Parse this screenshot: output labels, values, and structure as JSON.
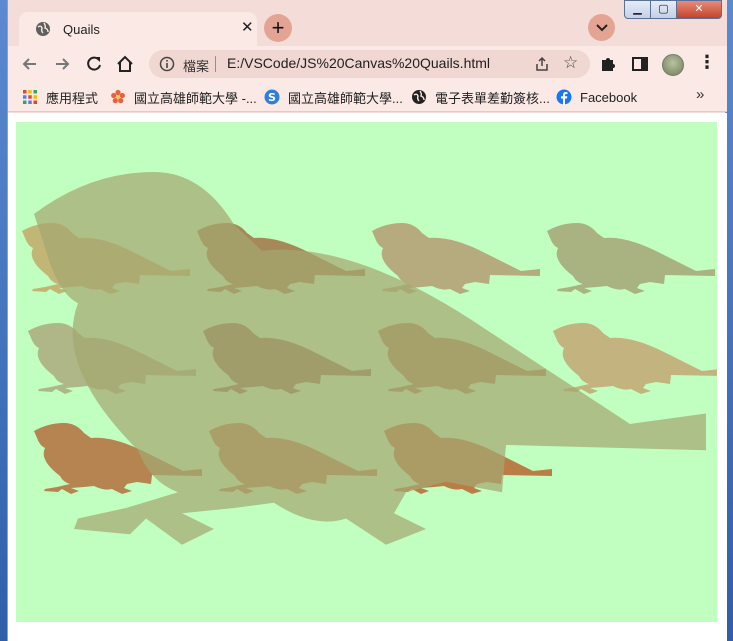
{
  "tab": {
    "title": "Quails",
    "favicon": "globe-icon",
    "close": "✕"
  },
  "new_tab": "+",
  "window_controls": {
    "minimize": "▁",
    "maximize": "▢",
    "close": "✕"
  },
  "toolbar": {
    "back": "back-arrow-icon",
    "forward": "forward-arrow-icon",
    "reload": "reload-icon",
    "home": "home-icon",
    "extensions": "puzzle-icon",
    "side_panel": "side-panel-icon",
    "menu": "⋮"
  },
  "omnibox": {
    "label": "檔案",
    "url": "E:/VSCode/JS%20Canvas%20Quails.html"
  },
  "bookmarks": {
    "items": [
      {
        "label": "應用程式",
        "icon": "apps-grid-icon"
      },
      {
        "label": "國立高雄師範大學 -...",
        "icon": "nknu-flower-icon"
      },
      {
        "label": "國立高雄師範大學...",
        "icon": "s-logo-icon"
      },
      {
        "label": "電子表單差勤簽核...",
        "icon": "globe-icon"
      },
      {
        "label": "Facebook",
        "icon": "facebook-icon"
      }
    ],
    "more": "»"
  },
  "canvas": {
    "background": "#c0ffc0",
    "big_quail": {
      "color": "#a3a870"
    },
    "small_quails": [
      {
        "color": "#c2a96a"
      },
      {
        "color": "#a27345"
      },
      {
        "color": "#b49c72"
      },
      {
        "color": "#a4a575"
      },
      {
        "color": "#acaa7e"
      },
      {
        "color": "#8f6d48"
      },
      {
        "color": "#aa7d4e"
      },
      {
        "color": "#c3a672"
      },
      {
        "color": "#b36e3c"
      },
      {
        "color": "#be7443"
      },
      {
        "color": "#b9662f"
      }
    ]
  }
}
